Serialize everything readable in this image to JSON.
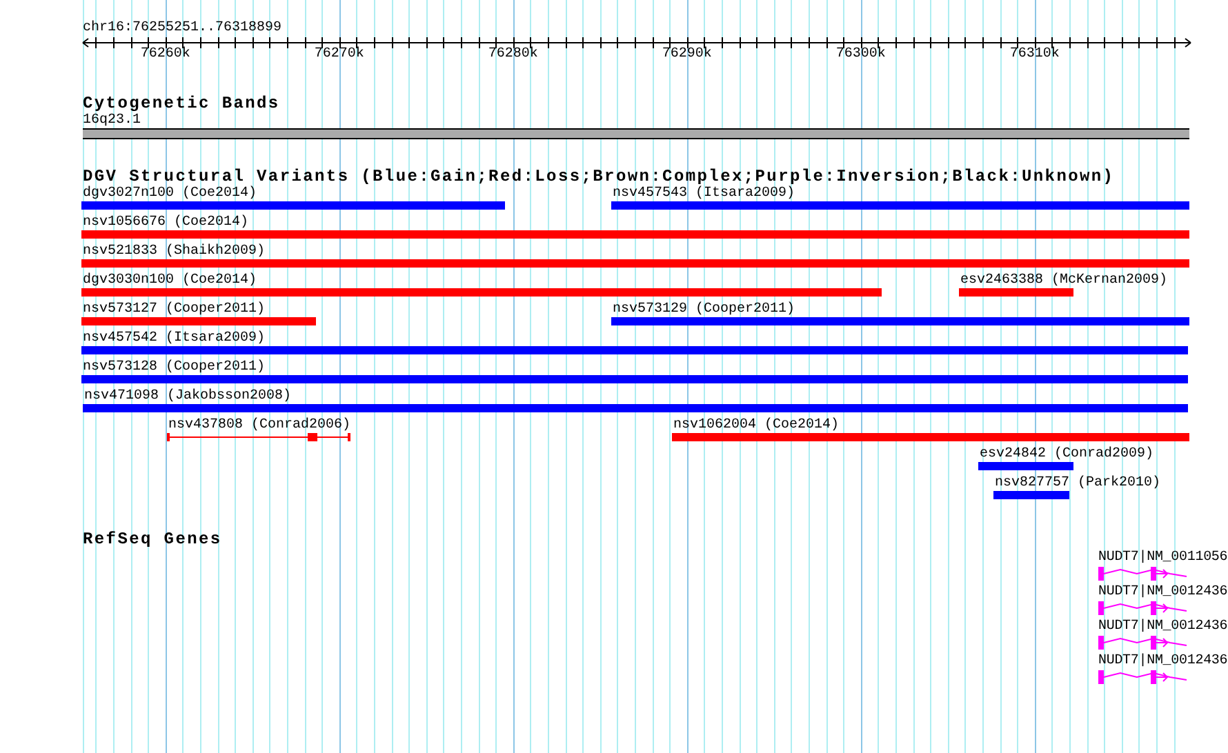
{
  "ruler": {
    "location": "chr16:76255251..76318899",
    "ticks": [
      "76260k",
      "76270k",
      "76280k",
      "76290k",
      "76300k",
      "76310k"
    ]
  },
  "tracks": [
    {
      "kind": "cytoband",
      "title": "Cytogenetic Bands",
      "band_label": "16q23.1"
    },
    {
      "kind": "variants",
      "title": "DGV Structural Variants (Blue:Gain;Red:Loss;Brown:Complex;Purple:Inversion;Black:Unknown)",
      "features": [
        {
          "kind": "bar",
          "label": "dgv3027n100 (Coe2014)",
          "color": "#0000ff"
        },
        {
          "kind": "bar",
          "label": "nsv457543 (Itsara2009)",
          "color": "#0000ff"
        },
        {
          "kind": "bar",
          "label": "nsv1056676 (Coe2014)",
          "color": "#ff0000"
        },
        {
          "kind": "bar",
          "label": "nsv521833 (Shaikh2009)",
          "color": "#ff0000"
        },
        {
          "kind": "bar",
          "label": "dgv3030n100 (Coe2014)",
          "color": "#ff0000"
        },
        {
          "kind": "bar",
          "label": "esv2463388 (McKernan2009)",
          "color": "#ff0000"
        },
        {
          "kind": "bar",
          "label": "nsv573127 (Cooper2011)",
          "color": "#ff0000"
        },
        {
          "kind": "bar",
          "label": "nsv573129 (Cooper2011)",
          "color": "#0000ff"
        },
        {
          "kind": "bar",
          "label": "nsv457542 (Itsara2009)",
          "color": "#0000ff"
        },
        {
          "kind": "bar",
          "label": "nsv573128 (Cooper2011)",
          "color": "#0000ff"
        },
        {
          "kind": "bar",
          "label": "nsv471098 (Jakobsson2008)",
          "color": "#0000ff"
        },
        {
          "kind": "segmented",
          "label": "nsv437808 (Conrad2006)",
          "color": "#ff0000"
        },
        {
          "kind": "bar",
          "label": "nsv1062004 (Coe2014)",
          "color": "#ff0000"
        },
        {
          "kind": "bar",
          "label": "esv24842 (Conrad2009)",
          "color": "#0000ff"
        },
        {
          "kind": "bar",
          "label": "nsv827757 (Park2010)",
          "color": "#0000ff"
        }
      ]
    },
    {
      "kind": "genes",
      "title": "RefSeq Genes",
      "features": [
        {
          "label": "NUDT7|NM_0011056"
        },
        {
          "label": "NUDT7|NM_0012436"
        },
        {
          "label": "NUDT7|NM_0012436"
        },
        {
          "label": "NUDT7|NM_0012436"
        }
      ]
    }
  ]
}
